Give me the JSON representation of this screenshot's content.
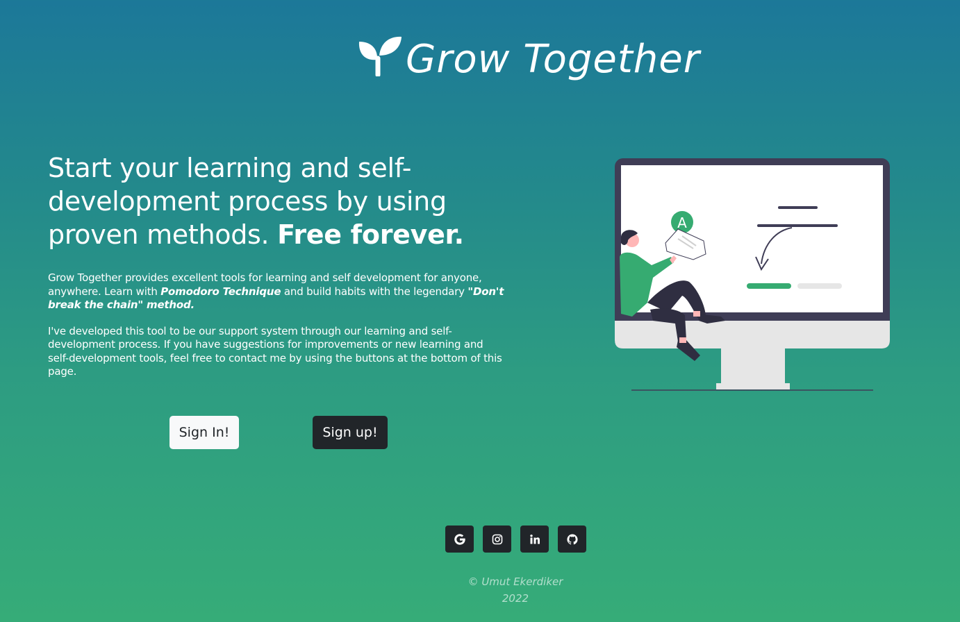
{
  "brand": {
    "name": "Grow Together",
    "icon": "sprout-icon"
  },
  "hero": {
    "headline_regular": "Start your learning and self-development process by using proven methods.",
    "headline_bold": "Free forever.",
    "para1": {
      "part1": "Grow Together provides excellent tools for learning and self development for anyone, anywhere. Learn with ",
      "pomodoro": "Pomodoro Technique",
      "part2": " and build habits with the legendary ",
      "dont_break": "\"Don't break the chain\" method."
    },
    "para2": "I've developed this tool to be our support system through our learning and self-development process. If you have suggestions for improvements or new learning and self-development tools, feel free to contact me by using the buttons at the bottom of this page."
  },
  "buttons": {
    "signin": "Sign In!",
    "signup": "Sign up!"
  },
  "illustration": {
    "letter": "A"
  },
  "socials": [
    {
      "icon": "google-icon"
    },
    {
      "icon": "instagram-icon"
    },
    {
      "icon": "linkedin-icon"
    },
    {
      "icon": "github-icon"
    }
  ],
  "footer": {
    "author": "© Umut Ekerdiker",
    "year": "2022"
  },
  "colors": {
    "gradient_top": "#1c7899",
    "gradient_bottom": "#36ac78",
    "accent_green": "#36ab71",
    "dark": "#212529",
    "monitor_frame": "#3f3d56"
  }
}
